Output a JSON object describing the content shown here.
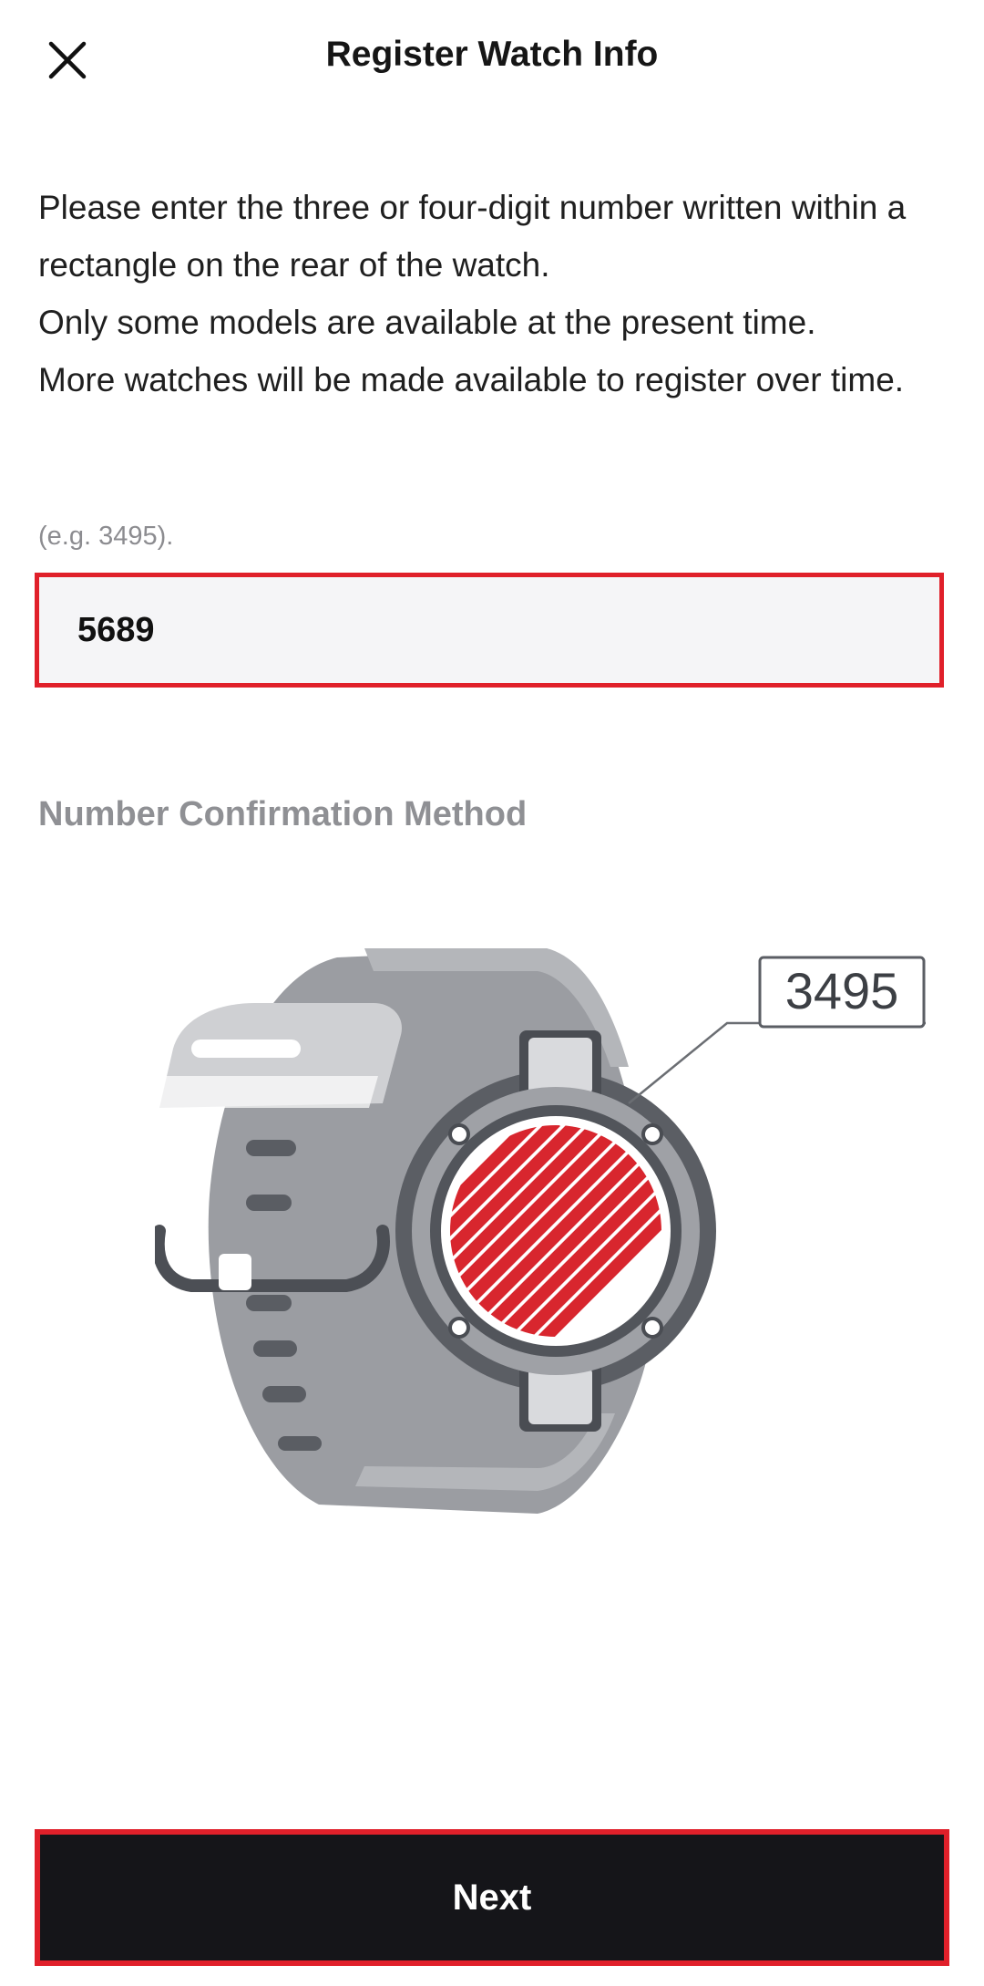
{
  "header": {
    "title": "Register Watch Info",
    "close_icon": "close-icon"
  },
  "intro": {
    "line1": "Please enter the three or four-digit number written within a rectangle on the rear of the watch.",
    "line2": "Only some models are available at the present time.",
    "line3": "More watches will be made available to register over time."
  },
  "field": {
    "hint": "(e.g. 3495).",
    "value": "5689"
  },
  "confirmation": {
    "title": "Number Confirmation Method",
    "example_number": "3495"
  },
  "footer": {
    "next_label": "Next"
  },
  "colors": {
    "highlight": "#e0202a",
    "button_bg": "#151519",
    "section_title": "#8f9094",
    "watch_red": "#d8262e"
  }
}
